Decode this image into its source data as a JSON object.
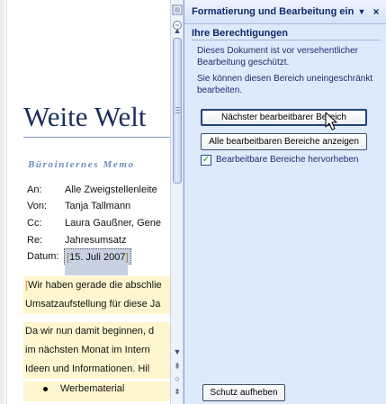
{
  "document": {
    "title": "Weite Welt",
    "subtitle": "Bürointernes Memo",
    "header_rows": [
      {
        "label": "An:",
        "value": "Alle Zweigstellenleite"
      },
      {
        "label": "Von:",
        "value": "Tanja Tallmann"
      },
      {
        "label": "Cc:",
        "value": "Laura Gaußner, Gene"
      },
      {
        "label": "Re:",
        "value": "Jahresumsatz"
      }
    ],
    "date_label": "Datum:",
    "date_value": "15. Juli 2007",
    "para1": [
      "Wir haben gerade die abschlie",
      "Umsatzaufstellung für diese Ja"
    ],
    "para2": [
      "Da wir nun damit beginnen, d",
      "im nächsten Monat im Intern",
      "Ideen und Informationen. Hil"
    ],
    "bullet": "Werbematerial"
  },
  "scrollbar": {
    "up_arrow": "▲",
    "down_arrow": "▼",
    "prev_page": "⇞",
    "select_browse": "○",
    "next_page": "⇟"
  },
  "task_pane": {
    "title": "Formatierung und Bearbeitung ein",
    "dropdown_icon": "▼",
    "close_icon": "×",
    "section_heading": "Ihre Berechtigungen",
    "info1": "Dieses Dokument ist vor versehentlicher Bearbeitung geschützt.",
    "info2": "Sie können diesen Bereich uneingeschränkt bearbeiten.",
    "btn_next": "Nächster bearbeitbarer Bereich",
    "btn_all": "Alle bearbeitbaren Bereiche anzeigen",
    "checkbox_label": "Bearbeitbare Bereiche hervorheben",
    "checkbox_checked": true,
    "checkmark": "✓",
    "btn_remove": "Schutz aufheben"
  }
}
